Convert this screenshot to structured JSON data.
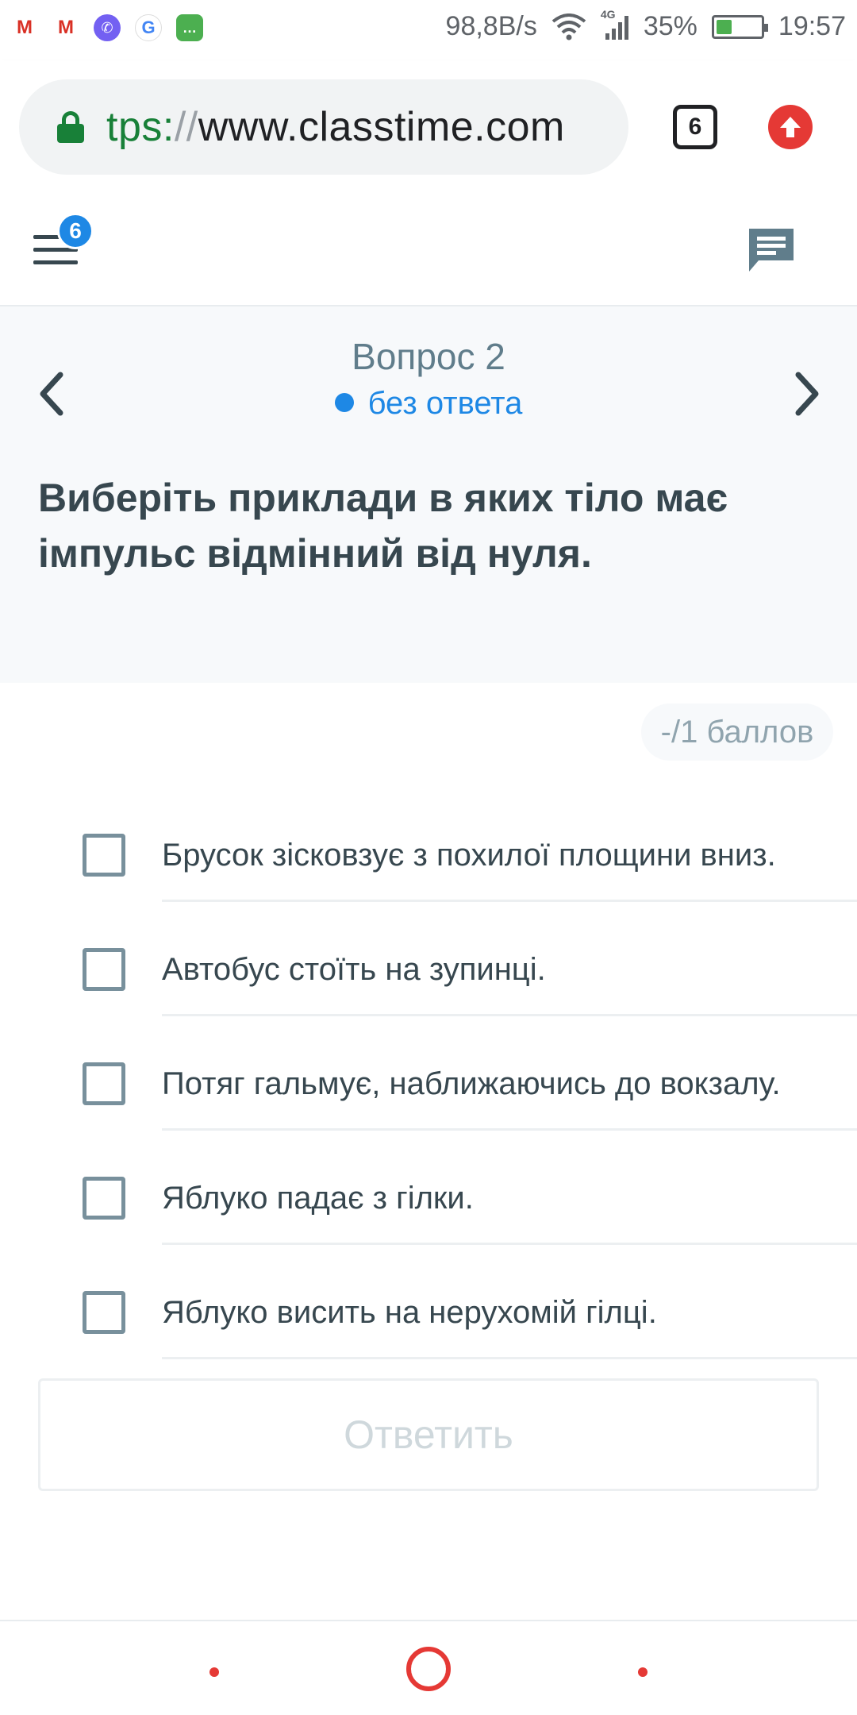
{
  "status_bar": {
    "app_icons": [
      "gmail-icon",
      "gmail-icon",
      "viber-icon",
      "google-icon",
      "messages-icon"
    ],
    "network_speed": "98,8B/s",
    "signal_label": "4G",
    "battery": "35%",
    "battery_level": 0.35,
    "time": "19:57"
  },
  "browser": {
    "url_scheme": "tps:",
    "url_sep": "//",
    "url_host": "www.classtime.com",
    "tab_count": "6"
  },
  "header": {
    "menu_badge": "6"
  },
  "question": {
    "title": "Вопрос 2",
    "status": "без ответа",
    "text": "Виберіть приклади в яких тіло має імпульс відмінний від нуля.",
    "points": "-/1 баллов"
  },
  "options": [
    {
      "label": "Брусок зісковзує з похилої площини вниз.",
      "checked": false
    },
    {
      "label": "Автобус стоїть на зупинці.",
      "checked": false
    },
    {
      "label": "Потяг гальмує, наближаючись до вокзалу.",
      "checked": false
    },
    {
      "label": "Яблуко падає з гілки.",
      "checked": false
    },
    {
      "label": "Яблуко висить на нерухомій гілці.",
      "checked": false
    }
  ],
  "submit_label": "Ответить",
  "colors": {
    "accent": "#1e88e5",
    "text": "#37474f",
    "muted": "#90a4ae",
    "secure_green": "#188038",
    "system_red": "#e53935"
  }
}
